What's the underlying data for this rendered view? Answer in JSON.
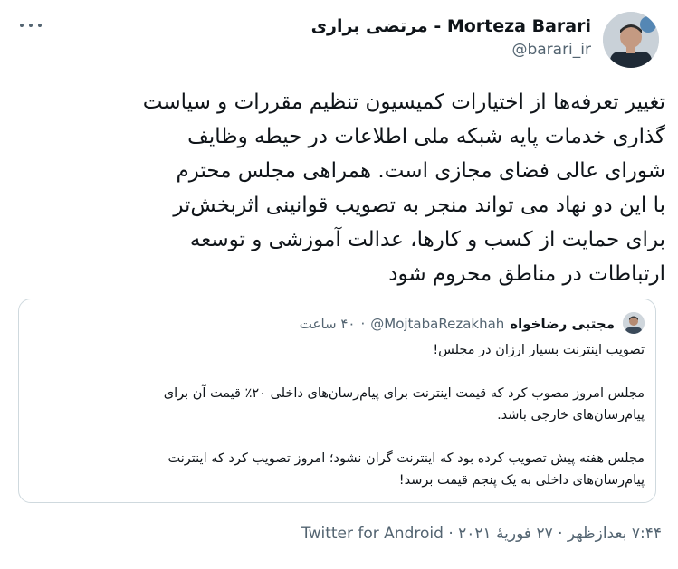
{
  "author": {
    "display_name": "مرتضی براری - Morteza Barari",
    "handle": "@barari_ir"
  },
  "tweet": {
    "lines": [
      "تغییر تعرفه‌ها از اختیارات کمیسیون تنظیم مقررات و سیاست",
      "گذاری خدمات پایه شبکه ملی اطلاعات در حیطه وظایف",
      "شورای عالی فضای مجازی است. همراهی مجلس محترم",
      "با این دو نهاد می تواند منجر به تصویب قوانینی اثربخش‌تر",
      "برای حمایت از کسب و کارها، عدالت آموزشی و توسعه",
      "ارتباطات در مناطق محروم شود"
    ]
  },
  "quoted": {
    "display_name": "مجتبی رضاخواه",
    "handle": "@MojtabaRezakhah",
    "separator": "·",
    "time": "۴۰ ساعت",
    "paragraphs": [
      [
        "تصویب اینترنت بسیار ارزان در مجلس!"
      ],
      [
        "مجلس امروز مصوب کرد که قیمت اینترنت برای پیام‌رسان‌های داخلی ۲۰٪ قیمت آن برای",
        "پیام‌رسان‌های خارجی باشد."
      ],
      [
        "مجلس هفته پیش تصویب کرده بود که اینترنت گران نشود؛ امروز تصویب کرد که اینترنت",
        "پیام‌رسان‌های داخلی به یک پنجم قیمت برسد!"
      ]
    ]
  },
  "footer": {
    "time": "۷:۴۴ بعدازظهر",
    "separator": "·",
    "date": "۲۷ فوریهٔ ۲۰۲۱",
    "source": "Twitter for Android"
  },
  "colors": {
    "text": "#0f1419",
    "secondary": "#536471",
    "border": "#cfd9de"
  },
  "icons": {
    "more": "more-horizontal-icon"
  }
}
